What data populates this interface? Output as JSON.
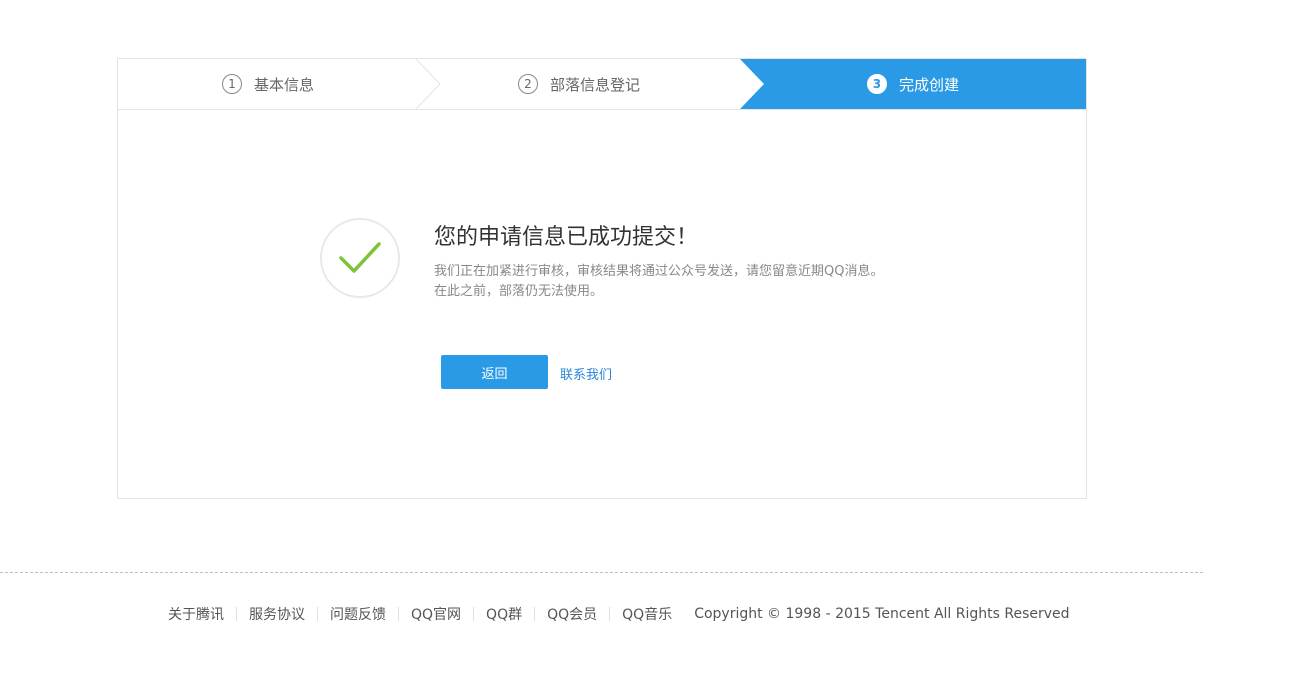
{
  "steps": [
    {
      "num": "1",
      "label": "基本信息",
      "active": false
    },
    {
      "num": "2",
      "label": "部落信息登记",
      "active": false
    },
    {
      "num": "3",
      "label": "完成创建",
      "active": true
    }
  ],
  "result": {
    "title": "您的申请信息已成功提交！",
    "desc_line1": "我们正在加紧进行审核，审核结果将通过公众号发送，请您留意近期QQ消息。",
    "desc_line2": "在此之前，部落仍无法使用。",
    "icon": "check-circle-icon"
  },
  "actions": {
    "back_label": "返回",
    "contact_label": "联系我们"
  },
  "footer": {
    "links": [
      "关于腾讯",
      "服务协议",
      "问题反馈",
      "QQ官网",
      "QQ群",
      "QQ会员",
      "QQ音乐"
    ],
    "copyright": "Copyright © 1998 - 2015 Tencent All Rights Reserved"
  },
  "colors": {
    "accent": "#2b9ae6",
    "check": "#7fc33a",
    "link": "#2b86d8"
  }
}
